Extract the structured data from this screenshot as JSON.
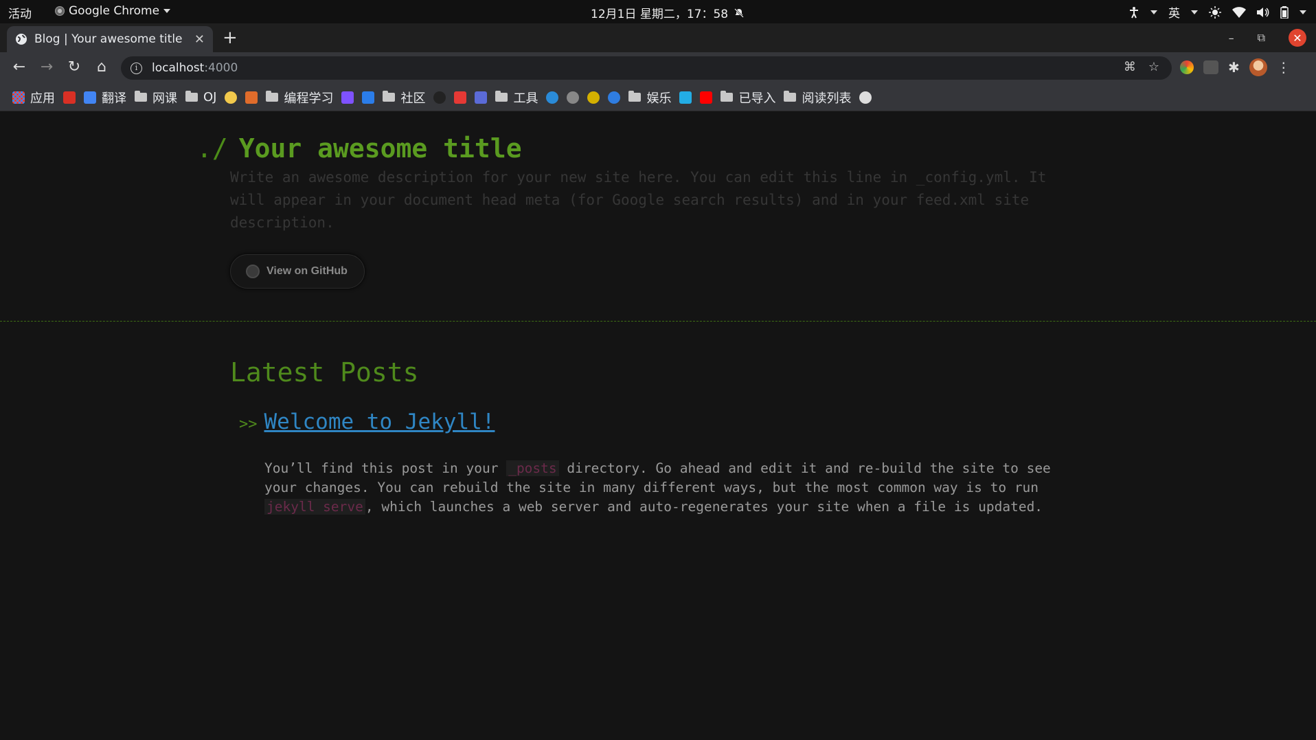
{
  "system_bar": {
    "activities": "活动",
    "app_name": "Google Chrome",
    "datetime": "12月1日 星期二，17：58",
    "input_method": "英"
  },
  "browser": {
    "tab_title": "Blog | Your awesome title",
    "url_host": "localhost",
    "url_port": ":4000",
    "bookmarks": [
      {
        "label": "应用",
        "icon": "apps-grid-icon",
        "color": "#e94235"
      },
      {
        "label": "",
        "icon": "gmail-icon",
        "color": "#d93025"
      },
      {
        "label": "翻译",
        "icon": "translate-icon",
        "color": "#4285f4"
      },
      {
        "label": "网课",
        "icon": "folder-icon"
      },
      {
        "label": "OJ",
        "icon": "folder-icon"
      },
      {
        "label": "",
        "icon": "smiley-icon",
        "color": "#f2c94c"
      },
      {
        "label": "",
        "icon": "flame-icon",
        "color": "#e06c2b"
      },
      {
        "label": "编程学习",
        "icon": "folder-icon"
      },
      {
        "label": "",
        "icon": "kotlin-icon",
        "color": "#7f52ff"
      },
      {
        "label": "",
        "icon": "code-icon",
        "color": "#2b7de9"
      },
      {
        "label": "社区",
        "icon": "folder-icon"
      },
      {
        "label": "",
        "icon": "github-icon",
        "color": "#222222"
      },
      {
        "label": "",
        "icon": "g-icon",
        "color": "#e53935"
      },
      {
        "label": "",
        "icon": "layers-icon",
        "color": "#5b6bd8"
      },
      {
        "label": "工具",
        "icon": "folder-icon"
      },
      {
        "label": "",
        "icon": "bing-icon",
        "color": "#2a8bd8"
      },
      {
        "label": "",
        "icon": "cat-icon",
        "color": "#888888"
      },
      {
        "label": "",
        "icon": "yellow-mark-icon",
        "color": "#d4b000"
      },
      {
        "label": "",
        "icon": "compass-icon",
        "color": "#2f7de1"
      },
      {
        "label": "娱乐",
        "icon": "folder-icon"
      },
      {
        "label": "",
        "icon": "bilibili-icon",
        "color": "#23ade5"
      },
      {
        "label": "",
        "icon": "youtube-icon",
        "color": "#ff0000"
      },
      {
        "label": "已导入",
        "icon": "folder-icon"
      },
      {
        "label": "阅读列表",
        "icon": "folder-icon"
      },
      {
        "label": "",
        "icon": "globe-icon",
        "color": "#dddddd"
      }
    ]
  },
  "site": {
    "prompt": "./",
    "title": "Your awesome title",
    "description": "Write an awesome description for your new site here. You can edit this line in _config.yml. It will appear in your document head meta (for Google search results) and in your feed.xml site description.",
    "github_button": "View on GitHub",
    "latest_heading": "Latest Posts",
    "post_arrow": ">>",
    "post_title": "Welcome to Jekyll!",
    "excerpt": {
      "part1": "You’ll find this post in your ",
      "code1": "_posts",
      "part2": " directory. Go ahead and edit it and re-build the site to see your changes. You can rebuild the site in many different ways, but the most common way is to run ",
      "code2": "jekyll serve",
      "part3": ", which launches a web server and auto-regenerates your site when a file is updated."
    }
  },
  "colors": {
    "accent_green": "#5a9b20",
    "link_blue": "#2f86c4",
    "page_bg": "#141414"
  }
}
